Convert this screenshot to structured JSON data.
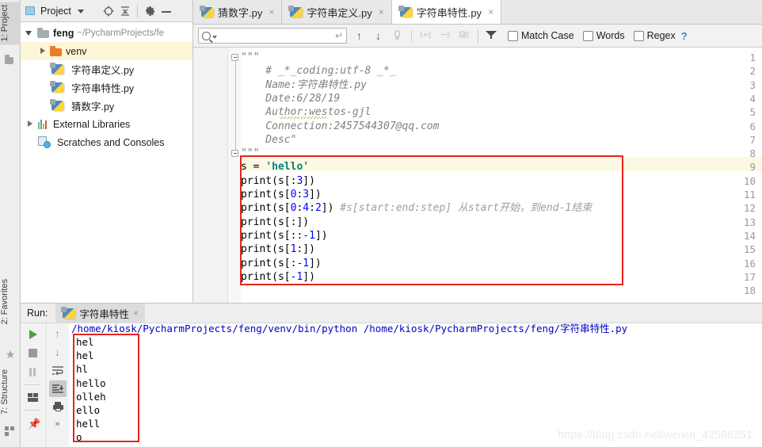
{
  "rail": {
    "top_tab": "1: Project",
    "bottom_tabs": [
      "2: Favorites",
      "7: Structure"
    ],
    "icons": [
      "folder-icon",
      "star-icon",
      "structure-icon"
    ]
  },
  "project_panel": {
    "title": "Project",
    "header_icons": [
      "project-view-icon",
      "chevron-down-icon",
      "locate-icon",
      "collapse-all-icon",
      "gear-icon",
      "minimize-icon"
    ],
    "tree": [
      {
        "label": "feng",
        "path": "~/PycharmProjects/fe",
        "icon": "folder-gray",
        "twisty": "open",
        "indent": 6,
        "bold": true,
        "selected": false
      },
      {
        "label": "venv",
        "path": "",
        "icon": "folder-orange",
        "twisty": "closed",
        "indent": 22,
        "bold": false,
        "selected": true
      },
      {
        "label": "字符串定义.py",
        "path": "",
        "icon": "python-file",
        "twisty": "none",
        "indent": 38,
        "bold": false,
        "selected": false
      },
      {
        "label": "字符串特性.py",
        "path": "",
        "icon": "python-file",
        "twisty": "none",
        "indent": 38,
        "bold": false,
        "selected": false
      },
      {
        "label": "猜数字.py",
        "path": "",
        "icon": "python-file",
        "twisty": "none",
        "indent": 38,
        "bold": false,
        "selected": false
      },
      {
        "label": "External Libraries",
        "path": "",
        "icon": "library",
        "twisty": "closed",
        "indent": 6,
        "bold": false,
        "selected": false
      },
      {
        "label": "Scratches and Consoles",
        "path": "",
        "icon": "scratch",
        "twisty": "none",
        "indent": 22,
        "bold": false,
        "selected": false
      }
    ]
  },
  "editor_tabs": [
    {
      "label": "猜数字.py",
      "icon": "python-file",
      "active": false,
      "close": "×"
    },
    {
      "label": "字符串定义.py",
      "icon": "python-file",
      "active": false,
      "close": "×"
    },
    {
      "label": "字符串特性.py",
      "icon": "python-file",
      "active": true,
      "close": "×"
    }
  ],
  "findbar": {
    "search_value": "",
    "search_placeholder": "",
    "return_glyph": "↵",
    "nav_icons": [
      "find-previous-icon",
      "find-next-icon",
      "select-all-occurrences-icon",
      "add-selection-icon",
      "remove-selection-icon",
      "select-all-icon",
      "filter-icon"
    ],
    "up_glyph": "↑",
    "down_glyph": "↓",
    "checkboxes": [
      {
        "label": "Match Case",
        "checked": false
      },
      {
        "label": "Words",
        "checked": false
      },
      {
        "label": "Regex",
        "checked": false
      }
    ],
    "help": "?"
  },
  "editor": {
    "highlight_line": 9,
    "lines": [
      {
        "n": 1,
        "text": "\"\"\""
      },
      {
        "n": 2,
        "text": "    # _*_coding:utf-8 _*_"
      },
      {
        "n": 3,
        "text": "    Name:字符串特性.py"
      },
      {
        "n": 4,
        "text": "    Date:6/28/19"
      },
      {
        "n": 5,
        "text": "    Author:westos-gjl"
      },
      {
        "n": 6,
        "text": "    Connection:2457544307@qq.com"
      },
      {
        "n": 7,
        "text": "    Desc\""
      },
      {
        "n": 8,
        "text": "\"\"\""
      },
      {
        "n": 9,
        "text": "s = 'hello'"
      },
      {
        "n": 10,
        "text": "print(s[:3])"
      },
      {
        "n": 11,
        "text": "print(s[0:3])"
      },
      {
        "n": 12,
        "text": "print(s[0:4:2])",
        "comment": "#s[start:end:step] 从start开始，到end-1结束"
      },
      {
        "n": 13,
        "text": "print(s[:])"
      },
      {
        "n": 14,
        "text": "print(s[::-1])"
      },
      {
        "n": 15,
        "text": "print(s[1:])"
      },
      {
        "n": 16,
        "text": "print(s[:-1])"
      },
      {
        "n": 17,
        "text": "print(s[-1])"
      },
      {
        "n": 18,
        "text": ""
      }
    ],
    "annotation_box": "red-rectangle-lines-9-17"
  },
  "run_panel": {
    "label": "Run:",
    "tab_label": "字符串特性",
    "tab_close": "×",
    "toolbar_left": [
      "run-icon",
      "stop-icon",
      "pause-icon",
      "layout-icon",
      "pin-icon"
    ],
    "toolbar_right": [
      "up-arrow-icon",
      "down-arrow-icon",
      "soft-wrap-icon",
      "scroll-to-end-icon",
      "print-icon",
      "expand-icon"
    ],
    "command": "/home/kiosk/PycharmProjects/feng/venv/bin/python /home/kiosk/PycharmProjects/feng/字符串特性.py",
    "output": [
      "hel",
      "hel",
      "hl",
      "hello",
      "olleh",
      "ello",
      "hell",
      "o"
    ],
    "annotation_box": "red-rectangle-output"
  },
  "watermark": "https://blog.csdn.net/weixin_42566251",
  "colors": {
    "accent_red": "#e8241c",
    "string_green": "#008080",
    "number_blue": "#0000ff",
    "comment_gray": "#9e9e9e",
    "caret_line": "#fdf8e3",
    "console_blue": "#0000c0",
    "run_green": "#4aa23f"
  }
}
